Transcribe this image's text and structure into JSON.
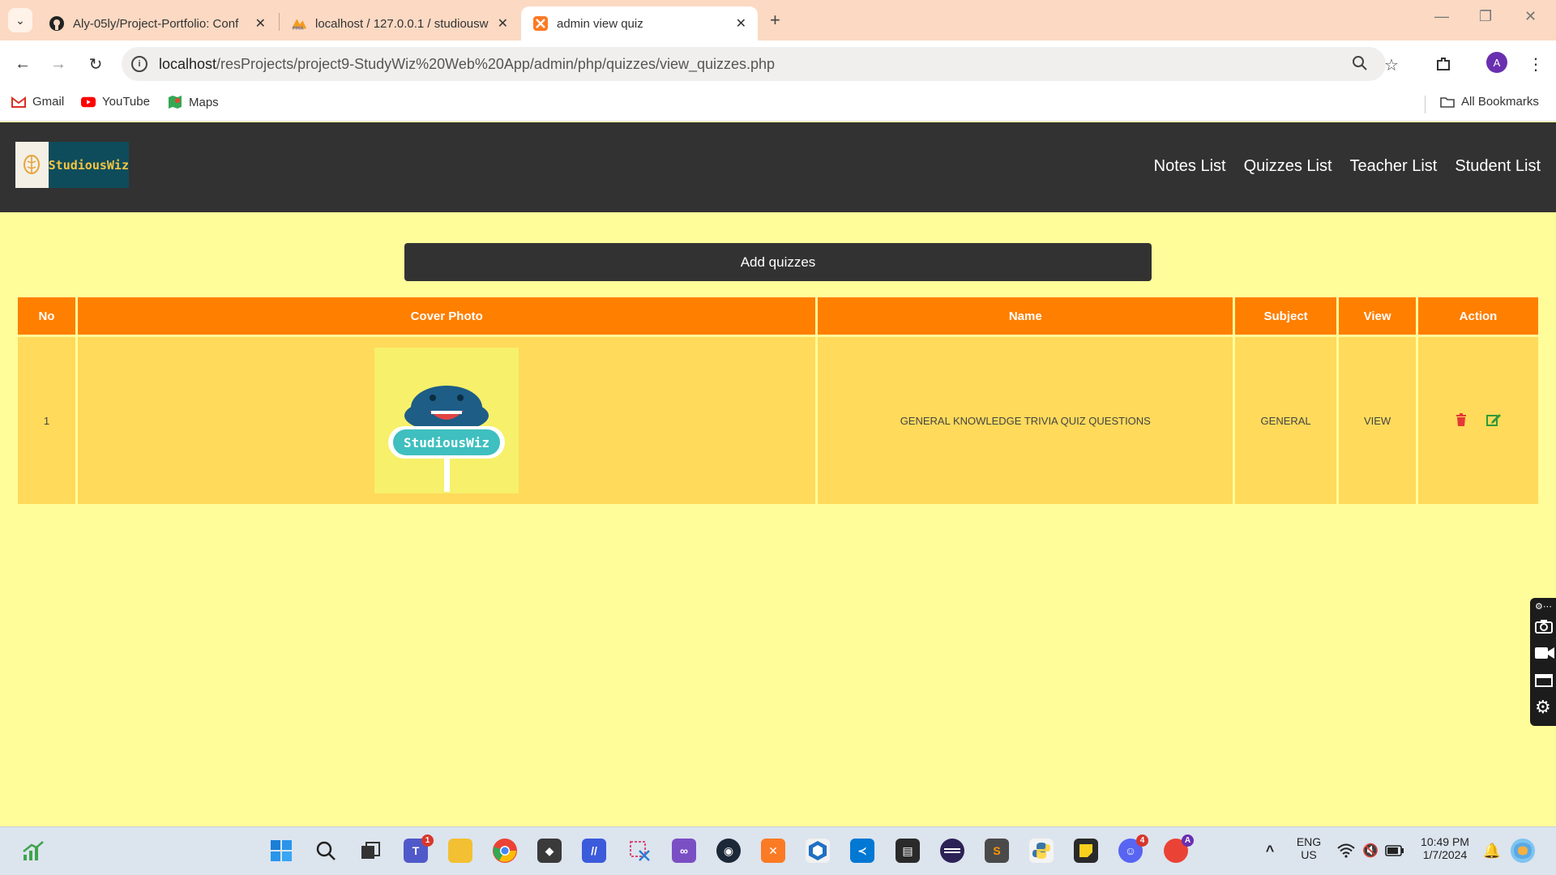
{
  "browser": {
    "tabs": [
      {
        "title": "Aly-05ly/Project-Portfolio: Conf",
        "icon": "github-icon"
      },
      {
        "title": "localhost / 127.0.0.1 / studiousw",
        "icon": "phpmyadmin-icon"
      },
      {
        "title": "admin view quiz",
        "icon": "xampp-icon",
        "active": true
      }
    ],
    "url_host": "localhost",
    "url_path": "/resProjects/project9-StudyWiz%20Web%20App/admin/php/quizzes/view_quizzes.php",
    "profile_initial": "A",
    "bookmarks": [
      "Gmail",
      "YouTube",
      "Maps"
    ],
    "all_bookmarks": "All Bookmarks"
  },
  "site": {
    "logo_text": "StudiousWiz",
    "menu": [
      "Notes List",
      "Quizzes List",
      "Teacher List",
      "Student List"
    ],
    "add_button": "Add quizzes",
    "table": {
      "headers": [
        "No",
        "Cover Photo",
        "Name",
        "Subject",
        "View",
        "Action"
      ],
      "rows": [
        {
          "no": "1",
          "cover_text": "StudiousWiz",
          "name": "GENERAL KNOWLEDGE TRIVIA QUIZ QUESTIONS",
          "subject": "GENERAL",
          "view": "VIEW"
        }
      ]
    }
  },
  "taskbar": {
    "teams_badge": "1",
    "discord_badge": "4",
    "chrome_profile": "A",
    "lang_line1": "ENG",
    "lang_line2": "US",
    "time": "10:49 PM",
    "date": "1/7/2024"
  },
  "colors": {
    "page_bg": "#fffc9a",
    "nav_bg": "#333232",
    "table_header": "#ff7f00",
    "table_row": "#ffda5b",
    "delete_icon": "#e53935",
    "edit_icon": "#2e9a3a"
  }
}
